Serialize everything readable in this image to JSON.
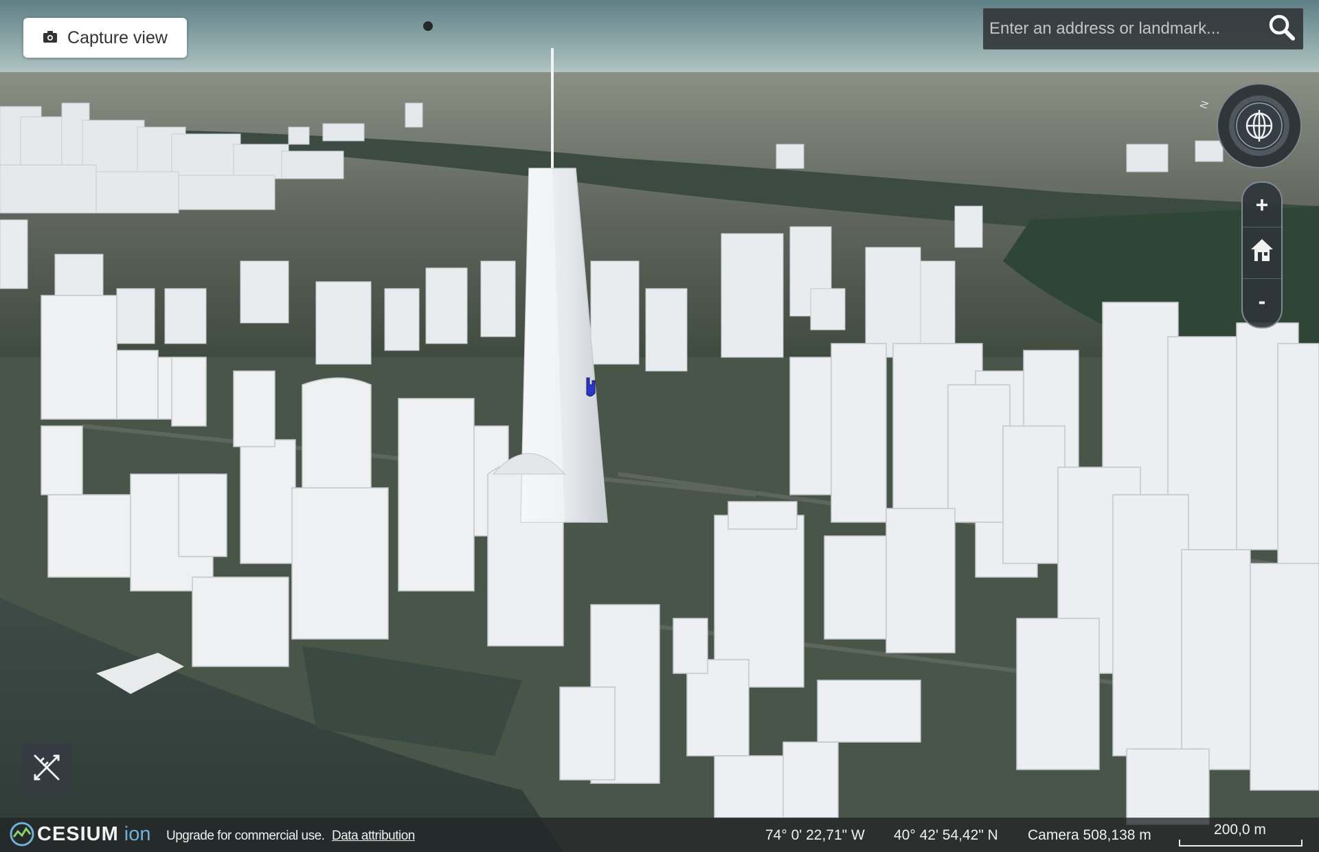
{
  "toolbar": {
    "capture_label": "Capture view",
    "capture_icon": "camera-icon"
  },
  "search": {
    "placeholder": "Enter an address or landmark...",
    "value": "",
    "icon": "search-icon"
  },
  "navigation": {
    "compass_label": "N",
    "zoom_in_label": "+",
    "zoom_out_label": "-",
    "home_icon": "home-icon"
  },
  "tools": {
    "draw_icon": "ruler-pencil-icon"
  },
  "footer": {
    "logo_text": "CESIUM",
    "logo_suffix": "ion",
    "upgrade_text": "Upgrade for commercial use.",
    "attribution_link": "Data attribution",
    "longitude": "74° 0' 22,71\" W",
    "latitude": "40° 42' 54,42\" N",
    "camera_height": "Camera 508,138 m",
    "scale_label": "200,0 m"
  },
  "colors": {
    "building": "#eceff2",
    "water": "#3b4a46",
    "sky": "#6f8a8c",
    "accent_ion": "#6fb1d9"
  }
}
